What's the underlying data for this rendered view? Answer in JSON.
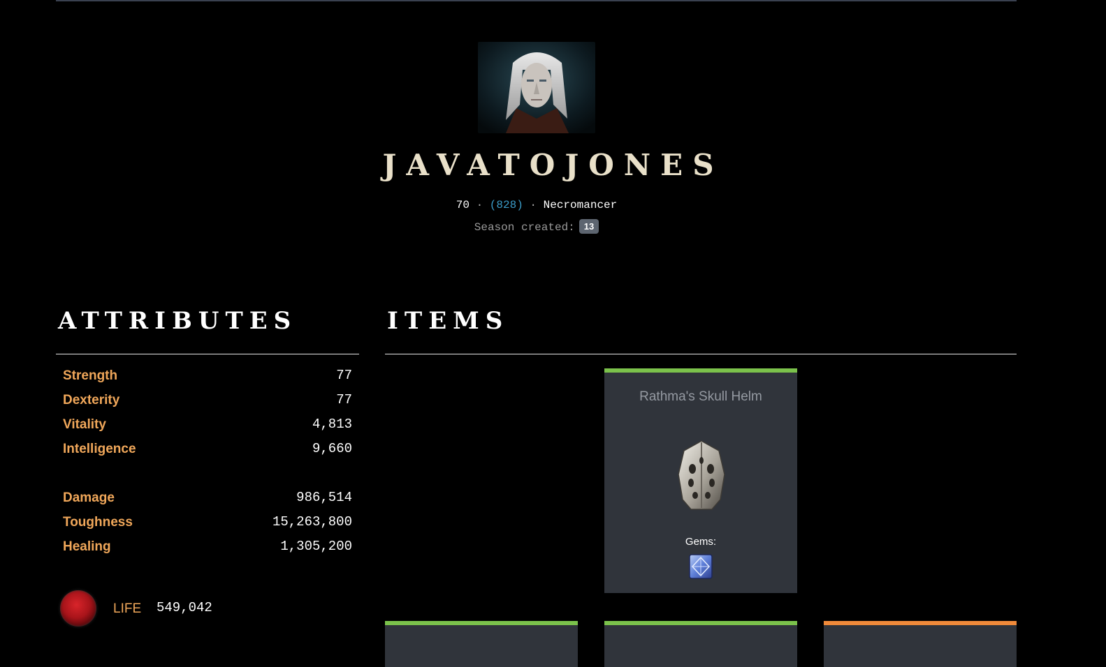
{
  "hero": {
    "name": "JavaToJones",
    "level": "70",
    "paragon": "(828)",
    "class": "Necromancer",
    "season_label": "Season created:",
    "season_value": "13",
    "portrait_icon": "necromancer-portrait"
  },
  "attributes": {
    "title": "Attributes",
    "primary": [
      {
        "label": "Strength",
        "value": "77"
      },
      {
        "label": "Dexterity",
        "value": "77"
      },
      {
        "label": "Vitality",
        "value": "4,813"
      },
      {
        "label": "Intelligence",
        "value": "9,660"
      }
    ],
    "secondary": [
      {
        "label": "Damage",
        "value": "986,514"
      },
      {
        "label": "Toughness",
        "value": "15,263,800"
      },
      {
        "label": "Healing",
        "value": "1,305,200"
      }
    ],
    "life": {
      "label": "LIFE",
      "value": "549,042",
      "icon": "life-orb-icon"
    }
  },
  "items": {
    "title": "Items",
    "cards": [
      {
        "name": "Rathma's Skull Helm",
        "gems_label": "Gems:",
        "rarity_color": "#7bc24b",
        "icon": "helm-icon",
        "gem_icon": "gem-icon"
      }
    ],
    "partial_cards": [
      {
        "rarity_color": "#7bc24b"
      },
      {
        "rarity_color": "#7bc24b"
      },
      {
        "rarity_color": "#f08a3a"
      }
    ]
  },
  "colors": {
    "accent_label": "#f0a75a",
    "paragon": "#3b9cc8",
    "set_item": "#7bc24b",
    "legendary_item": "#f08a3a",
    "card_bg": "#30343b"
  }
}
